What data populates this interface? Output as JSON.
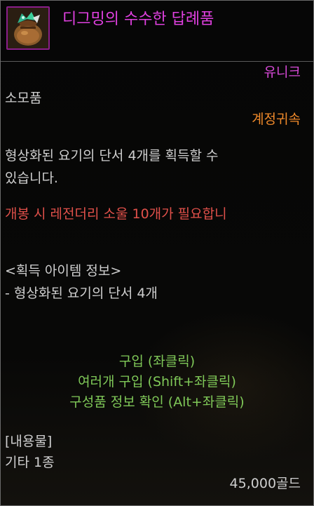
{
  "item": {
    "name": "디그밍의 수수한 답례품",
    "rarity": "유니크",
    "type": "소모품",
    "binding": "계정귀속",
    "description": [
      "형상화된 요기의 단서 4개를 획득할 수",
      "있습니다."
    ],
    "requirement": "개봉 시 레전더리 소울 10개가 필요합니",
    "acquire_header": "<획득 아이템 정보>",
    "acquire_item": "- 형상화된 요기의 단서 4개"
  },
  "actions": {
    "buy": "구입 (좌클릭)",
    "buy_many": "여러개 구입 (Shift+좌클릭)",
    "check_contents": "구성품 정보 확인 (Alt+좌클릭)"
  },
  "contents": {
    "header": "[내용물]",
    "summary": "기타 1종"
  },
  "price": "45,000골드",
  "colors": {
    "rarity": "#d84ad8",
    "binding": "#f08a2a",
    "requirement": "#e0504a",
    "action": "#7fc858"
  },
  "icon": "pouch-with-gems-icon"
}
